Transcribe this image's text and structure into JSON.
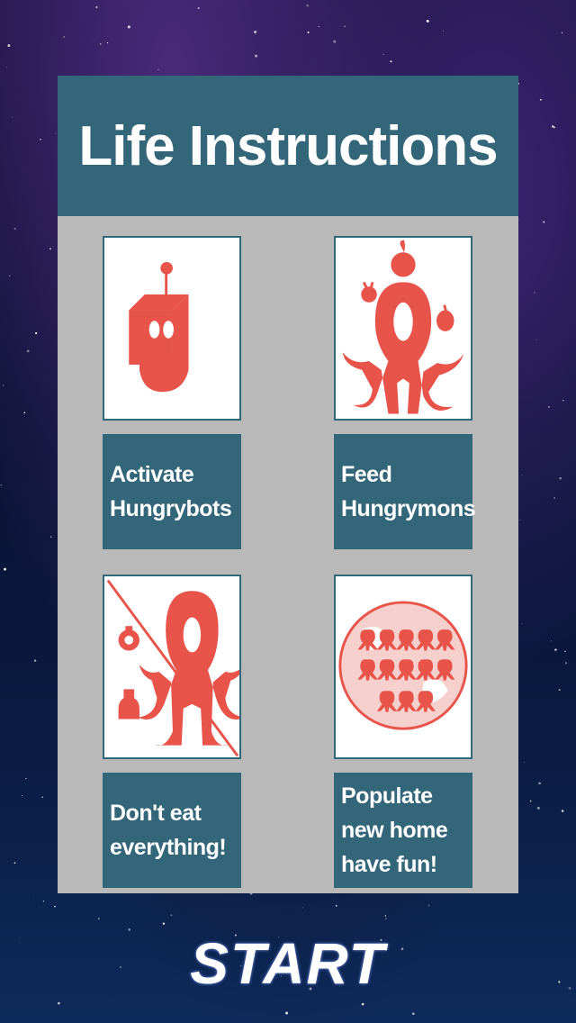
{
  "panel": {
    "title": "Life Instructions"
  },
  "cards": [
    {
      "label": "Activate\nHungrybots",
      "icon": "hungrybot-icon"
    },
    {
      "label": "Feed\nHungrymons",
      "icon": "hungrymon-feeding-icon"
    },
    {
      "label": "Don't eat\neverything!",
      "icon": "crossed-out-eating-icon"
    },
    {
      "label": "Populate\nnew home\nhave fun!",
      "icon": "populated-planet-icon"
    }
  ],
  "start_button": {
    "label": "START"
  },
  "colors": {
    "panel_header": "#34667a",
    "panel_body": "#b9b9b9",
    "illustration": "#e8534a",
    "card_background": "#ffffff"
  }
}
